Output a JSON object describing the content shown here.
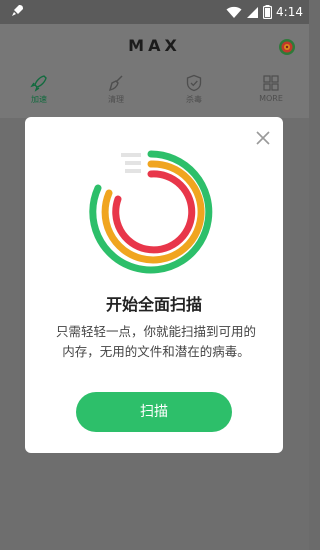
{
  "status_bar": {
    "time": "4:14",
    "icons": [
      "rocket-icon",
      "wifi-icon",
      "signal-icon",
      "battery-icon"
    ]
  },
  "header": {
    "logo": "MAX",
    "menu_icon": "target-icon"
  },
  "tabs": [
    {
      "label": "加速",
      "icon": "rocket-icon",
      "active": true
    },
    {
      "label": "清理",
      "icon": "broom-icon",
      "active": false
    },
    {
      "label": "杀毒",
      "icon": "shield-icon",
      "active": false
    },
    {
      "label": "MORE",
      "icon": "grid-icon",
      "active": false
    }
  ],
  "dialog": {
    "title": "开始全面扫描",
    "description": "只需轻轻一点，你就能扫描到可用的内存，无用的文件和潜在的病毒。",
    "button_label": "扫描",
    "close_icon": "close-icon"
  },
  "colors": {
    "accent": "#2dbf6a",
    "ring_green": "#2dbf6a",
    "ring_orange": "#f0a51f",
    "ring_red": "#e8364a"
  }
}
